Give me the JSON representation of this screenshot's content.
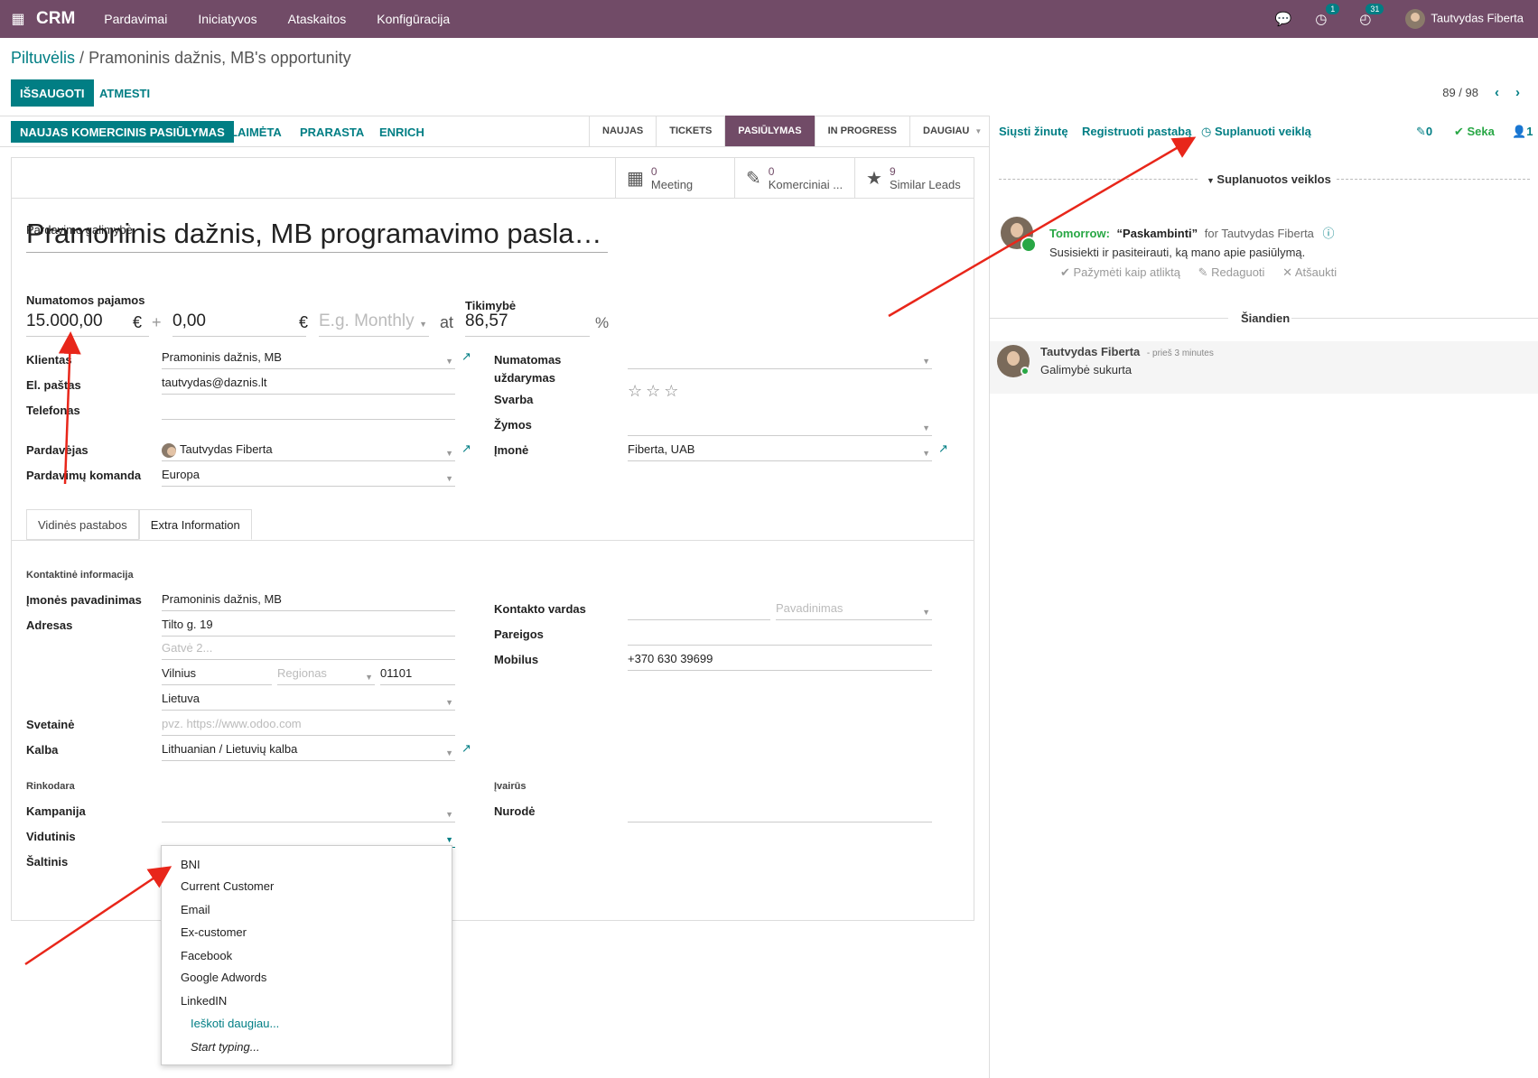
{
  "nav": {
    "app": "CRM",
    "menus": [
      "Pardavimai",
      "Iniciatyvos",
      "Ataskaitos",
      "Konfigūracija"
    ],
    "activity_badge": "1",
    "clock_badge": "31",
    "user": "Tautvydas Fiberta"
  },
  "breadcrumb": {
    "parent": "Piltuvėlis",
    "separator": "/",
    "current": "Pramoninis dažnis, MB's opportunity"
  },
  "control": {
    "save": "IŠSAUGOTI",
    "discard": "ATMESTI",
    "pager": "89 / 98"
  },
  "status": {
    "new_quote": "NAUJAS KOMERCINIS PASIŪLYMAS",
    "won": "LAIMĖTA",
    "lost": "PRARASTA",
    "enrich": "ENRICH",
    "stages": [
      "NAUJAS",
      "TICKETS",
      "PASIŪLYMAS",
      "IN PROGRESS",
      "DAUGIAU"
    ]
  },
  "smart_buttons": [
    {
      "num": "0",
      "label": "Meeting"
    },
    {
      "num": "0",
      "label": "Komerciniai ..."
    },
    {
      "num": "9",
      "label": "Similar Leads"
    }
  ],
  "form": {
    "opp_label": "Pardavimo galimybė",
    "title": "Pramoninis dažnis, MB programavimo pasla…",
    "revenue_label": "Numatomos pajamos",
    "revenue": "15.000,00",
    "currency": "€",
    "plus": "+",
    "recurring": "0,00",
    "plan_placeholder": "E.g. Monthly",
    "at": "at",
    "probability_label": "Tikimybė",
    "probability": "86,57",
    "percent": "%",
    "customer_label": "Klientas",
    "customer": "Pramoninis dažnis, MB",
    "email_label": "El. paštas",
    "email": "tautvydas@daznis.lt",
    "phone_label": "Telefonas",
    "salesperson_label": "Pardavėjas",
    "salesperson": "Tautvydas Fiberta",
    "team_label": "Pardavimų komanda",
    "team": "Europa",
    "close_label_1": "Numatomas",
    "close_label_2": "uždarymas",
    "priority_label": "Svarba",
    "stars": "☆☆☆",
    "tags_label": "Žymos",
    "company_label": "Įmonė",
    "company": "Fiberta, UAB"
  },
  "tabs": [
    "Vidinės pastabos",
    "Extra Information"
  ],
  "extra": {
    "contact_section": "Kontaktinė informacija",
    "company_name_label": "Įmonės pavadinimas",
    "company_name": "Pramoninis dažnis, MB",
    "address_label": "Adresas",
    "street": "Tilto g. 19",
    "street2_placeholder": "Gatvė 2...",
    "city": "Vilnius",
    "region_placeholder": "Regionas",
    "zip": "01101",
    "country": "Lietuva",
    "website_label": "Svetainė",
    "website_placeholder": "pvz. https://www.odoo.com",
    "language_label": "Kalba",
    "language": "Lithuanian / Lietuvių kalba",
    "contact_name_label": "Kontakto vardas",
    "title_placeholder": "Pavadinimas",
    "function_label": "Pareigos",
    "mobile_label": "Mobilus",
    "mobile": "+370 630 39699",
    "marketing_section": "Rinkodara",
    "campaign_label": "Kampanija",
    "medium_label": "Vidutinis",
    "source_label": "Šaltinis",
    "misc_section": "Įvairūs",
    "referred_label": "Nurodė"
  },
  "dropdown": {
    "items": [
      "BNI",
      "Current Customer",
      "Email",
      "Ex-customer",
      "Facebook",
      "Google Adwords",
      "LinkedIN"
    ],
    "search_more": "Ieškoti daugiau...",
    "start_typing": "Start typing..."
  },
  "chatter": {
    "send_message": "Siųsti žinutę",
    "log_note": "Registruoti pastabą",
    "schedule": "Suplanuoti veiklą",
    "attachments": "0",
    "follow": "Seka",
    "followers": "1",
    "planned_header": "Suplanuotos veiklos",
    "activity_when": "Tomorrow:",
    "activity_title": "“Paskambinti”",
    "activity_for": "for Tautvydas Fiberta",
    "activity_desc": "Susisiekti ir pasiteirauti, ką mano apie pasiūlymą.",
    "mark_done": "Pažymėti kaip atliktą",
    "edit": "Redaguoti",
    "cancel": "Atšaukti",
    "today": "Šiandien",
    "msg_author": "Tautvydas Fiberta",
    "msg_time": "- prieš 3 minutes",
    "msg_body": "Galimybė sukurta"
  },
  "colors": {
    "brand": "#714b67",
    "accent": "#017e84",
    "annotation": "#e8261a"
  }
}
